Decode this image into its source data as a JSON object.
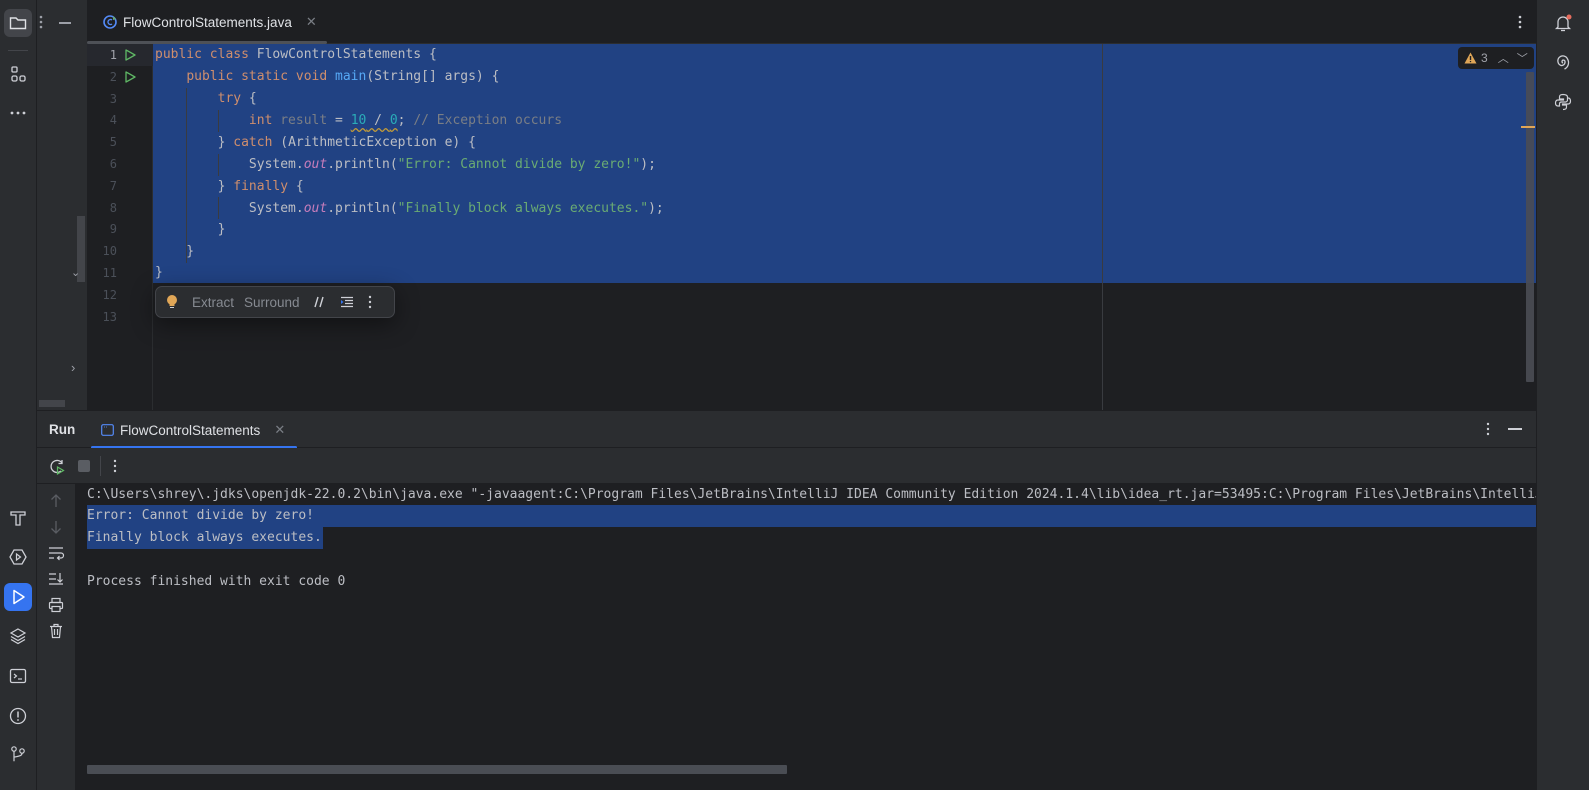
{
  "left_strip": {
    "top_items": [
      {
        "name": "project",
        "icon": "folder-icon",
        "active": true
      },
      {
        "name": "structure",
        "icon": "structure-icon"
      },
      {
        "name": "more",
        "icon": "more-horizontal-icon"
      }
    ],
    "bottom_items": [
      {
        "name": "build",
        "icon": "hammer-icon"
      },
      {
        "name": "services",
        "icon": "services-icon"
      },
      {
        "name": "run",
        "icon": "run-icon",
        "active": true
      },
      {
        "name": "layers",
        "icon": "layers-icon"
      },
      {
        "name": "terminal",
        "icon": "terminal-icon"
      },
      {
        "name": "problems",
        "icon": "problems-icon"
      },
      {
        "name": "git",
        "icon": "git-icon"
      }
    ]
  },
  "right_strip": {
    "items": [
      {
        "name": "notifications",
        "icon": "bell-icon",
        "badge": true
      },
      {
        "name": "ai-assistant",
        "icon": "spiral-icon"
      },
      {
        "name": "python",
        "icon": "python-icon"
      }
    ]
  },
  "editor": {
    "tab": {
      "label": "FlowControlStatements.java",
      "icon": "java-class-icon"
    },
    "line_numbers": [
      "1",
      "2",
      "3",
      "4",
      "5",
      "6",
      "7",
      "8",
      "9",
      "10",
      "11",
      "12",
      "13"
    ],
    "current_line": 1,
    "run_gutter_lines": [
      1,
      2
    ],
    "code": {
      "l1": {
        "kw1": "public",
        "kw2": "class",
        "rest": "FlowControlStatements {"
      },
      "l2": {
        "indent": "    ",
        "kw": "public static void",
        "fn": "main",
        "rest": "(String[] args) {"
      },
      "l3": {
        "indent": "        ",
        "kw": "try",
        "rest": " {"
      },
      "l4": {
        "indent": "            ",
        "kw": "int",
        "var": "result",
        "eq": " = ",
        "n1": "10",
        "op": " / ",
        "n2": "0",
        "semi": ";",
        "comment": "// Exception occurs"
      },
      "l5": {
        "indent": "        ",
        "brace": "} ",
        "kw": "catch",
        "rest": " (ArithmeticException e) {"
      },
      "l6": {
        "indent": "            ",
        "pre": "System.",
        "field": "out",
        "mid": ".println(",
        "str": "\"Error: Cannot divide by zero!\"",
        "end": ");"
      },
      "l7": {
        "indent": "        ",
        "brace": "} ",
        "kw": "finally",
        "rest": " {"
      },
      "l8": {
        "indent": "            ",
        "pre": "System.",
        "field": "out",
        "mid": ".println(",
        "str": "\"Finally block always executes.\"",
        "end": ");"
      },
      "l9": {
        "text": "        }"
      },
      "l10": {
        "text": "    }"
      },
      "l11": {
        "text": "}"
      }
    },
    "inspection": {
      "warnings": "3",
      "icon": "warning-icon"
    },
    "floating_toolbar": {
      "bulb_icon": "lightbulb-icon",
      "extract": "Extract",
      "surround": "Surround",
      "comment_icon": "comment-icon",
      "reformat_icon": "reformat-icon",
      "more_icon": "more-vertical-icon"
    }
  },
  "run_panel": {
    "title": "Run",
    "tab_label": "FlowControlStatements",
    "console": {
      "command": "C:\\Users\\shrey\\.jdks\\openjdk-22.0.2\\bin\\java.exe \"-javaagent:C:\\Program Files\\JetBrains\\IntelliJ IDEA Community Edition 2024.1.4\\lib\\idea_rt.jar=53495:C:\\Program Files\\JetBrains\\IntelliJ",
      "lines": [
        "Error: Cannot divide by zero!",
        "Finally block always executes.",
        "",
        "Process finished with exit code 0"
      ]
    }
  },
  "colors": {
    "selection": "#214283",
    "accent": "#3574f0",
    "keyword": "#cf8e6d",
    "string": "#6aab73",
    "function": "#56a8f5",
    "number": "#2aacb8",
    "warning": "#e0a657"
  }
}
